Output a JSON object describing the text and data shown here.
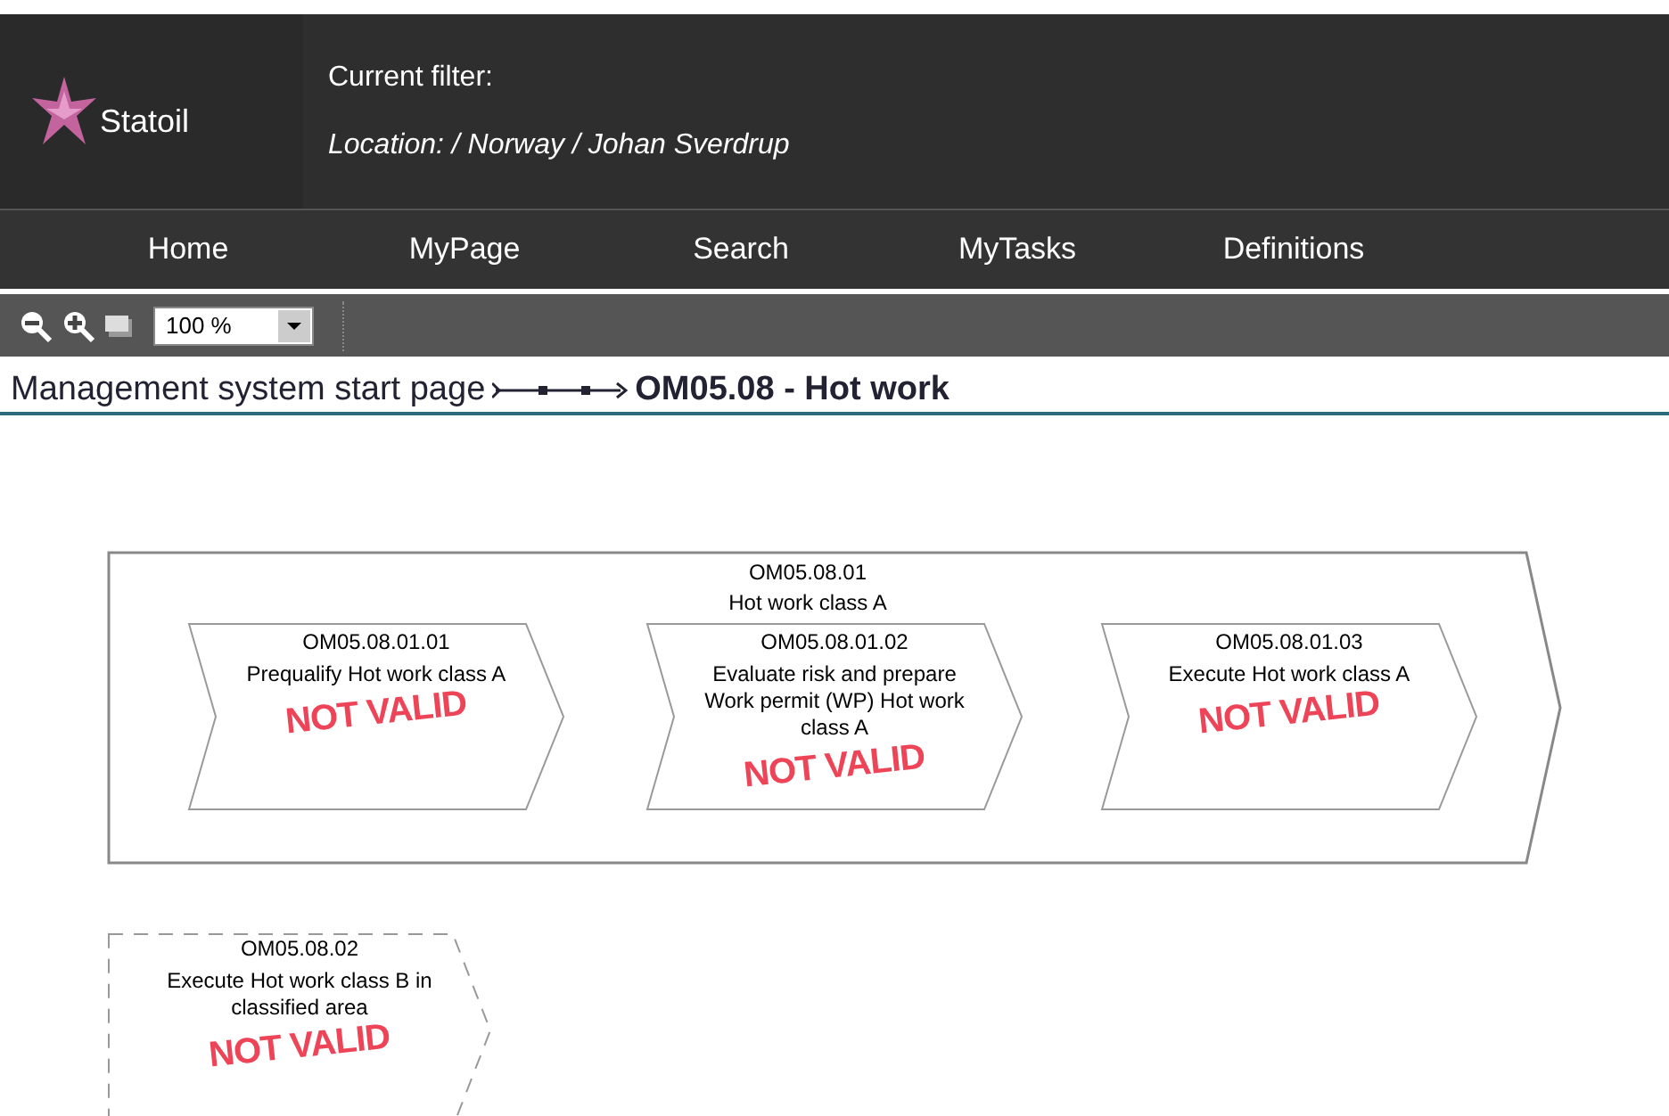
{
  "header": {
    "logo_text": "Statoil",
    "filter_label": "Current filter:",
    "filter_value": "Location: / Norway / Johan Sverdrup"
  },
  "nav": [
    "Home",
    "MyPage",
    "Search",
    "MyTasks",
    "Definitions"
  ],
  "toolbar": {
    "zoom_value": "100 %"
  },
  "breadcrumb": {
    "link": "Management system start page",
    "current": "OM05.08 - Hot work"
  },
  "diagram": {
    "group": {
      "code": "OM05.08.01",
      "title": "Hot work class A",
      "children": [
        {
          "code": "OM05.08.01.01",
          "title": "Prequalify Hot work class A",
          "stamp": "NOT VALID"
        },
        {
          "code": "OM05.08.01.02",
          "title": "Evaluate risk and prepare Work permit (WP) Hot work class A",
          "stamp": "NOT VALID"
        },
        {
          "code": "OM05.08.01.03",
          "title": "Execute Hot work class A",
          "stamp": "NOT VALID"
        }
      ]
    },
    "nodes": [
      {
        "kind": "dashed",
        "code": "OM05.08.02",
        "title": "Execute Hot work class B in classified area",
        "stamp": "NOT VALID"
      }
    ]
  }
}
